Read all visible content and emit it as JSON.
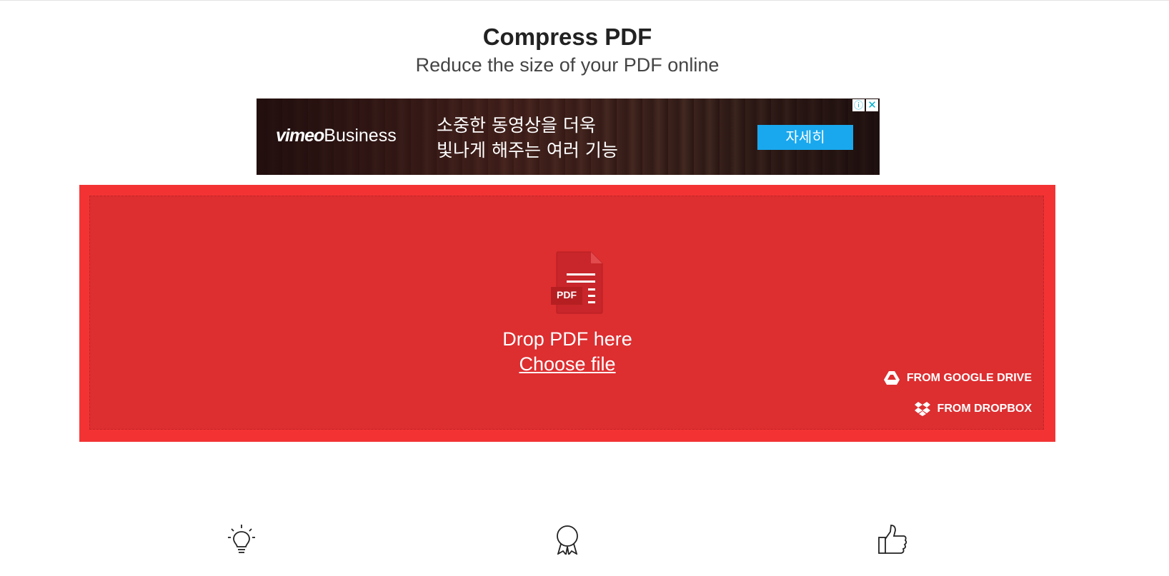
{
  "header": {
    "title": "Compress PDF",
    "subtitle": "Reduce the size of your PDF online"
  },
  "ad": {
    "brand_vimeo": "vimeo",
    "brand_business": "Business",
    "line1": "소중한 동영상을 더욱",
    "line2": "빛나게 해주는 여러 기능",
    "cta": "자세히",
    "info_icon": "info-icon",
    "close_icon": "close-icon",
    "cta_color": "#19a8ee"
  },
  "dropzone": {
    "icon": "pdf-file-icon",
    "icon_label": "PDF",
    "drop_text": "Drop PDF here",
    "choose_label": "Choose file",
    "google_drive_label": "FROM GOOGLE DRIVE",
    "dropbox_label": "FROM DROPBOX",
    "outer_color": "#f33333",
    "inner_color": "#dd2e30"
  },
  "features": {
    "icons": [
      "lightbulb-icon",
      "award-ribbon-icon",
      "thumbs-up-icon"
    ]
  }
}
